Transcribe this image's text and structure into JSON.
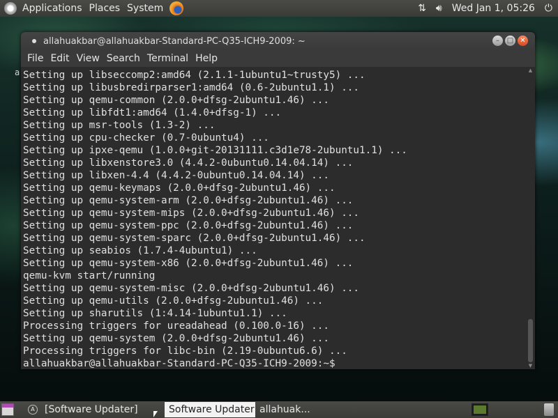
{
  "top_panel": {
    "menus": [
      "Applications",
      "Places",
      "System"
    ],
    "clock": "Wed Jan 1, 05:26",
    "icons": [
      "ubuntu-apps-icon",
      "firefox-icon",
      "network-icon",
      "volume-icon",
      "power-icon"
    ]
  },
  "desktop": {
    "stray_char": "a"
  },
  "terminal": {
    "title": "allahuakbar@allahuakbar-Standard-PC-Q35-ICH9-2009: ~",
    "menu": [
      "File",
      "Edit",
      "View",
      "Search",
      "Terminal",
      "Help"
    ],
    "lines": [
      "Setting up libseccomp2:amd64 (2.1.1-1ubuntu1~trusty5) ...",
      "Setting up libusbredirparser1:amd64 (0.6-2ubuntu1.1) ...",
      "Setting up qemu-common (2.0.0+dfsg-2ubuntu1.46) ...",
      "Setting up libfdt1:amd64 (1.4.0+dfsg-1) ...",
      "Setting up msr-tools (1.3-2) ...",
      "Setting up cpu-checker (0.7-0ubuntu4) ...",
      "Setting up ipxe-qemu (1.0.0+git-20131111.c3d1e78-2ubuntu1.1) ...",
      "Setting up libxenstore3.0 (4.4.2-0ubuntu0.14.04.14) ...",
      "Setting up libxen-4.4 (4.4.2-0ubuntu0.14.04.14) ...",
      "Setting up qemu-keymaps (2.0.0+dfsg-2ubuntu1.46) ...",
      "Setting up qemu-system-arm (2.0.0+dfsg-2ubuntu1.46) ...",
      "Setting up qemu-system-mips (2.0.0+dfsg-2ubuntu1.46) ...",
      "Setting up qemu-system-ppc (2.0.0+dfsg-2ubuntu1.46) ...",
      "Setting up qemu-system-sparc (2.0.0+dfsg-2ubuntu1.46) ...",
      "Setting up seabios (1.7.4-4ubuntu1) ...",
      "Setting up qemu-system-x86 (2.0.0+dfsg-2ubuntu1.46) ...",
      "qemu-kvm start/running",
      "Setting up qemu-system-misc (2.0.0+dfsg-2ubuntu1.46) ...",
      "Setting up qemu-utils (2.0.0+dfsg-2ubuntu1.46) ...",
      "Setting up sharutils (1:4.14-1ubuntu1.1) ...",
      "Processing triggers for ureadahead (0.100.0-16) ...",
      "Setting up qemu-system (2.0.0+dfsg-2ubuntu1.46) ...",
      "Processing triggers for libc-bin (2.19-0ubuntu6.6) ...",
      "allahuakbar@allahuakbar-Standard-PC-Q35-ICH9-2009:~$"
    ]
  },
  "taskbar": {
    "tasks": [
      "[Software Updater]",
      "Software Updater",
      "allahuak..."
    ]
  }
}
